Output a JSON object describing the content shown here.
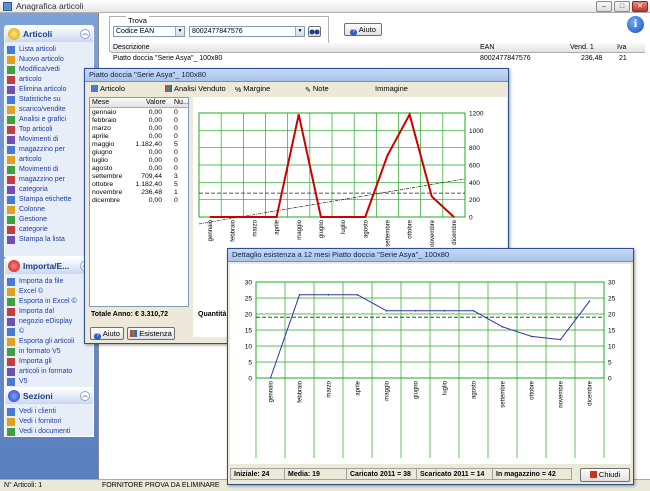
{
  "window": {
    "title": "Anagrafica articoli"
  },
  "sidebar": {
    "articoli": {
      "title": "Articoli",
      "items": [
        "Lista articoli",
        "Nuovo articolo",
        "Modifica/vedi",
        "articolo",
        "Elimina articolo",
        "Statistiche su",
        "scarico/vendite",
        "Analisi e grafici",
        "Top articoli",
        "Movimenti di",
        "magazzino per",
        "articolo",
        "Movimenti di",
        "magazzino per",
        "categoria",
        "Stampa etichette",
        "Colonne",
        "Gestione",
        "categorie",
        "Stampa la lista"
      ]
    },
    "importa": {
      "title": "Importa/E...",
      "items": [
        "Importa da file",
        "Excel ©",
        "Esporta in Excel ©",
        "Importa dal",
        "negozio eDisplay",
        "©",
        "Esporta gli articoli",
        "in formato V5",
        "Importa gli",
        "articoli in formato",
        "V5"
      ]
    },
    "sezioni": {
      "title": "Sezioni",
      "items": [
        "Vedi i clienti",
        "Vedi i fornitori",
        "Vedi i documenti"
      ]
    }
  },
  "search": {
    "group_label": "Trova",
    "field_type": "Codice EAN",
    "value": "8002477847576",
    "help_label": "Aiuto"
  },
  "grid": {
    "headers": [
      "Descrizione",
      "EAN",
      "Vend. 1",
      "Iva"
    ],
    "rows": [
      {
        "desc": "Piatto doccia \"Serie Asya\"_ 100x80",
        "ean": "8002477847576",
        "price": "236,48",
        "iva": "21"
      }
    ]
  },
  "status": {
    "count": "N° Articoli: 1",
    "supplier": "FORNITORE PROVA DA ELIMINARE"
  },
  "dialog1": {
    "title": "Piatto doccia \"Serie Asya\"_ 100x80",
    "tabs": [
      "Articolo",
      "Analisi Venduto",
      "Margine",
      "Note",
      "Immagine"
    ],
    "table_headers": [
      "Mese",
      "Valore",
      "Nu..."
    ],
    "rows": [
      [
        "gennaio",
        "0,00",
        "0"
      ],
      [
        "febbraio",
        "0,00",
        "0"
      ],
      [
        "marzo",
        "0,00",
        "0"
      ],
      [
        "aprile",
        "0,00",
        "0"
      ],
      [
        "maggio",
        "1.182,40",
        "5"
      ],
      [
        "giugno",
        "0,00",
        "0"
      ],
      [
        "luglio",
        "0,00",
        "0"
      ],
      [
        "agosto",
        "0,00",
        "0"
      ],
      [
        "settembre",
        "709,44",
        "3"
      ],
      [
        "ottobre",
        "1.182,40",
        "5"
      ],
      [
        "novembre",
        "236,48",
        "1"
      ],
      [
        "dicembre",
        "0,00",
        "0"
      ]
    ],
    "total_label": "Totale Anno: € 3.310,72",
    "quantity_label": "Quantità = 14",
    "help_btn": "Aiuto",
    "esistenza_btn": "Esistenza"
  },
  "dialog2": {
    "title": "Dettaglio esistenza a 12 mesi Piatto doccia \"Serie Asya\"_ 100x80",
    "stats": [
      "Iniziale: 24",
      "Media: 19",
      "Caricato 2011 = 38",
      "Scaricato 2011 = 14",
      "In magazzino = 42"
    ],
    "close_label": "Chiudi"
  },
  "chart_data": [
    {
      "type": "line",
      "categories": [
        "gennaio",
        "febbraio",
        "marzo",
        "aprile",
        "maggio",
        "giugno",
        "luglio",
        "agosto",
        "settembre",
        "ottobre",
        "novembre",
        "dicembre"
      ],
      "series": [
        {
          "values": [
            0,
            0,
            0,
            0,
            1182.4,
            0,
            0,
            0,
            709.44,
            1182.4,
            236.48,
            0
          ],
          "color": "#cc0000"
        }
      ],
      "ylim": [
        0,
        1200
      ],
      "yticks": [
        0,
        200,
        400,
        600,
        800,
        1000,
        1200
      ],
      "grid": true,
      "avg_line": 275.89,
      "trend": [
        -80,
        440
      ]
    },
    {
      "type": "line",
      "categories": [
        "gennaio",
        "febbraio",
        "marzo",
        "aprile",
        "maggio",
        "giugno",
        "luglio",
        "agosto",
        "settembre",
        "ottobre",
        "novembre",
        "dicembre"
      ],
      "series": [
        {
          "values": [
            0,
            26,
            26,
            26,
            21,
            21,
            21,
            21,
            16,
            13,
            12,
            24
          ],
          "color": "#3333aa"
        }
      ],
      "ylim": [
        0,
        30
      ],
      "yticks": [
        0,
        5,
        10,
        15,
        20,
        25,
        30
      ],
      "grid": true,
      "avg_line": 19
    }
  ],
  "colors": {
    "accent": "#2b4f8f",
    "chart1_line": "#cc0000",
    "chart2_line": "#3333aa",
    "grid_green": "#22aa22"
  }
}
